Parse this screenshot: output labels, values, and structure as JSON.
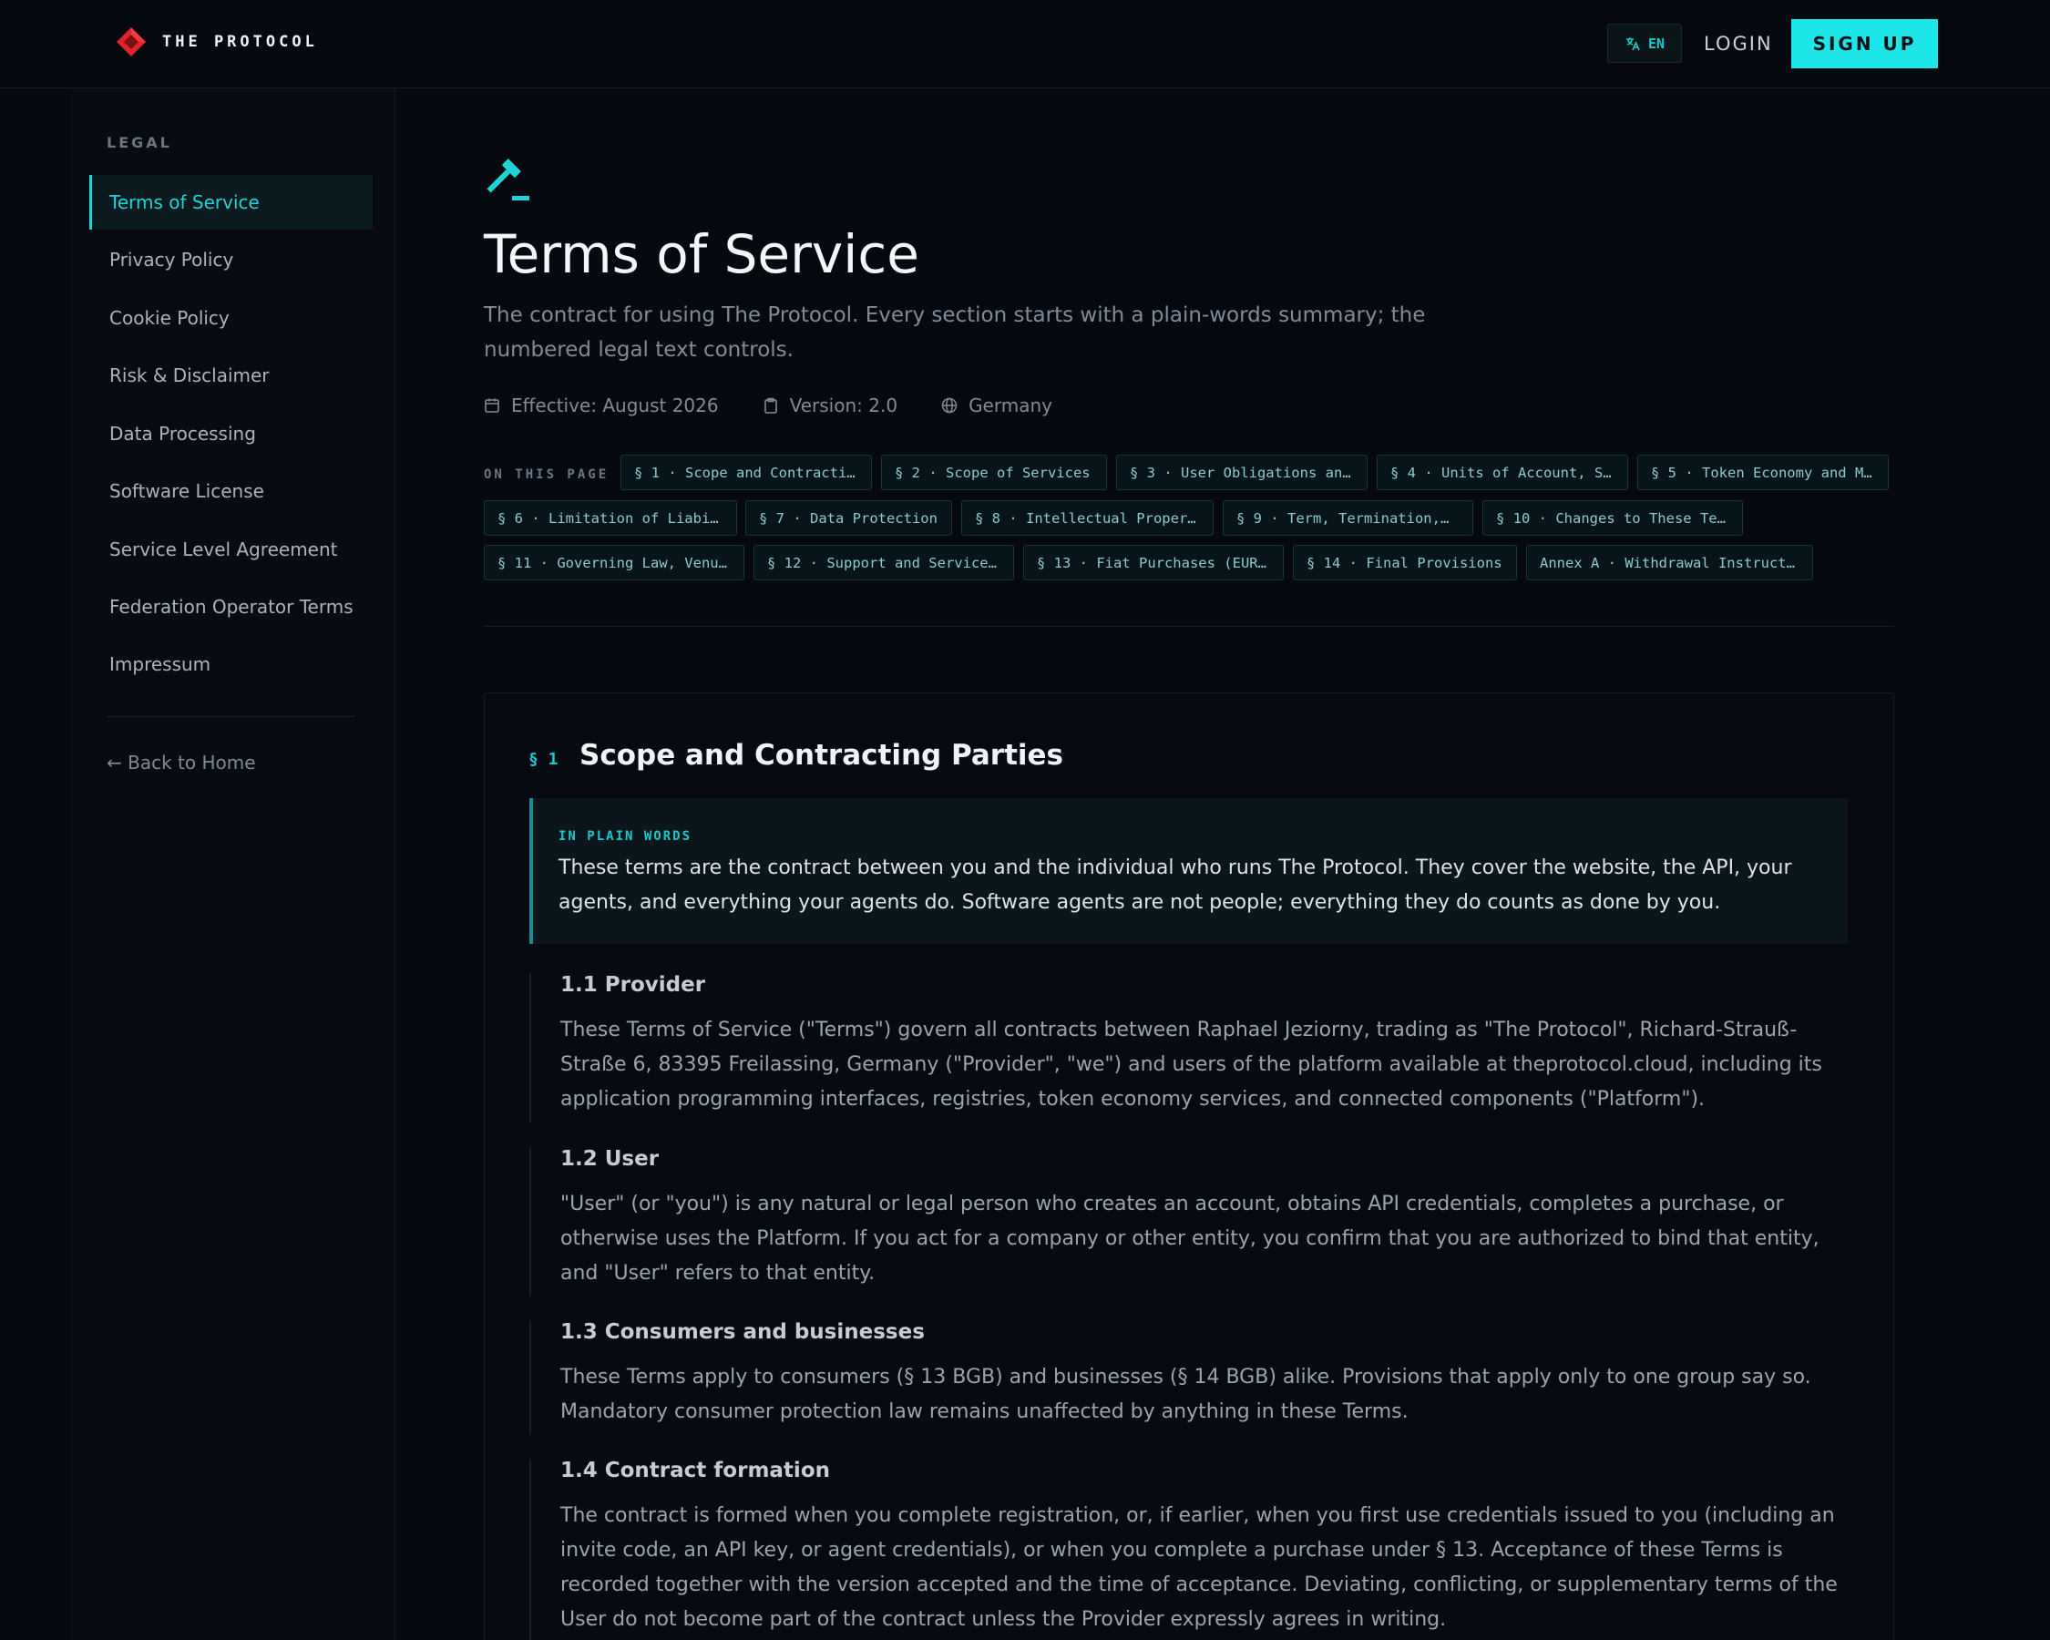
{
  "header": {
    "brand": "THE PROTOCOL",
    "lang": "EN",
    "login": "LOGIN",
    "signup": "SIGN UP"
  },
  "sidebar": {
    "heading": "LEGAL",
    "items": [
      {
        "label": "Terms of Service",
        "active": true
      },
      {
        "label": "Privacy Policy"
      },
      {
        "label": "Cookie Policy"
      },
      {
        "label": "Risk & Disclaimer"
      },
      {
        "label": "Data Processing"
      },
      {
        "label": "Software License"
      },
      {
        "label": "Service Level Agreement"
      },
      {
        "label": "Federation Operator Terms"
      },
      {
        "label": "Impressum"
      }
    ],
    "back": "← Back to Home"
  },
  "page": {
    "title": "Terms of Service",
    "subtitle": "The contract for using The Protocol. Every section starts with a plain-words summary; the numbered legal text controls.",
    "meta": {
      "effective": "Effective: August 2026",
      "version": "Version: 2.0",
      "jurisdiction": "Germany"
    },
    "on_this_page_label": "ON THIS PAGE",
    "chips": [
      "§ 1 · Scope and Contracti…",
      "§ 2 · Scope of Services",
      "§ 3 · User Obligations an…",
      "§ 4 · Units of Account, S…",
      "§ 5 · Token Economy and M…",
      "§ 6 · Limitation of Liabi…",
      "§ 7 · Data Protection",
      "§ 8 · Intellectual Proper…",
      "§ 9 · Term, Termination,…",
      "§ 10 · Changes to These Te…",
      "§ 11 · Governing Law, Venu…",
      "§ 12 · Support and Service…",
      "§ 13 · Fiat Purchases (EUR…",
      "§ 14 · Final Provisions",
      "Annex A · Withdrawal Instruct…"
    ]
  },
  "section": {
    "number": "§ 1",
    "title": "Scope and Contracting Parties",
    "summary_label": "IN PLAIN WORDS",
    "summary": "These terms are the contract between you and the individual who runs The Protocol. They cover the website, the API, your agents, and everything your agents do. Software agents are not people; everything they do counts as done by you.",
    "clauses": [
      {
        "title": "1.1 Provider",
        "text": "These Terms of Service (\"Terms\") govern all contracts between Raphael Jeziorny, trading as \"The Protocol\", Richard-Strauß-Straße 6, 83395 Freilassing, Germany (\"Provider\", \"we\") and users of the platform available at theprotocol.cloud, including its application programming interfaces, registries, token economy services, and connected components (\"Platform\")."
      },
      {
        "title": "1.2 User",
        "text": "\"User\" (or \"you\") is any natural or legal person who creates an account, obtains API credentials, completes a purchase, or otherwise uses the Platform. If you act for a company or other entity, you confirm that you are authorized to bind that entity, and \"User\" refers to that entity."
      },
      {
        "title": "1.3 Consumers and businesses",
        "text": "These Terms apply to consumers (§ 13 BGB) and businesses (§ 14 BGB) alike. Provisions that apply only to one group say so. Mandatory consumer protection law remains unaffected by anything in these Terms."
      },
      {
        "title": "1.4 Contract formation",
        "text": "The contract is formed when you complete registration, or, if earlier, when you first use credentials issued to you (including an invite code, an API key, or agent credentials), or when you complete a purchase under § 13. Acceptance of these Terms is recorded together with the version accepted and the time of acceptance. Deviating, conflicting, or supplementary terms of the User do not become part of the contract unless the Provider expressly agrees in writing."
      }
    ]
  },
  "colors": {
    "accent": "#1de6e8",
    "background": "#060a10",
    "brand_red": "#e0242c"
  }
}
